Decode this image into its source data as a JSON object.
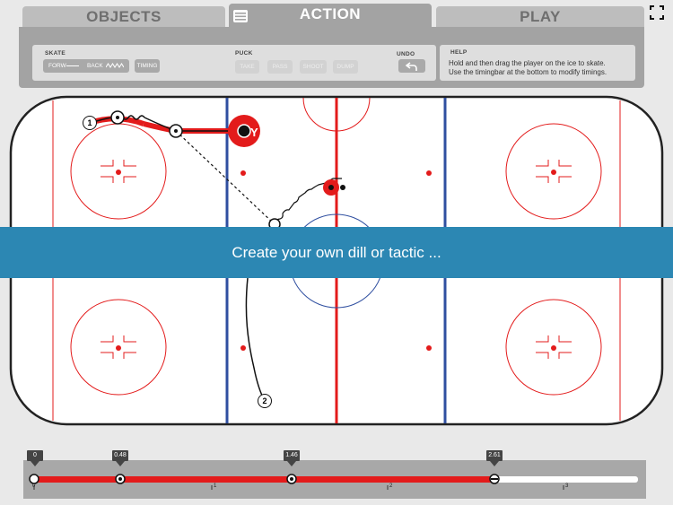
{
  "tabs": [
    {
      "label": "OBJECTS"
    },
    {
      "label": "ACTION"
    },
    {
      "label": "PLAY"
    }
  ],
  "skate": {
    "title": "SKATE",
    "forw": "FORW",
    "back": "BACK",
    "timing": "TIMING"
  },
  "puck": {
    "title": "PUCK",
    "take": "TAKE",
    "pass": "PASS",
    "shoot": "SHOOT",
    "dump": "DUMP"
  },
  "undo": {
    "title": "UNDO"
  },
  "help": {
    "title": "HELP",
    "line1": "Hold and then drag the player on the ice to skate.",
    "line2": "Use the timingbar at the bottom to modify timings."
  },
  "banner": {
    "text": "Create your own dill or tactic ..."
  },
  "rink": {
    "players": [
      {
        "label": "1"
      },
      {
        "label": "2"
      }
    ]
  },
  "timeline": {
    "markers": [
      {
        "label": "0"
      },
      {
        "label": "0.48"
      },
      {
        "label": "1.46"
      },
      {
        "label": "2.61"
      }
    ],
    "ticks": [
      "0",
      "1",
      "2",
      "3"
    ]
  },
  "colors": {
    "red": "#e31b1b",
    "blue": "#2f4fa0",
    "banner": "#2c87b3",
    "panel": "#a3a3a3"
  }
}
